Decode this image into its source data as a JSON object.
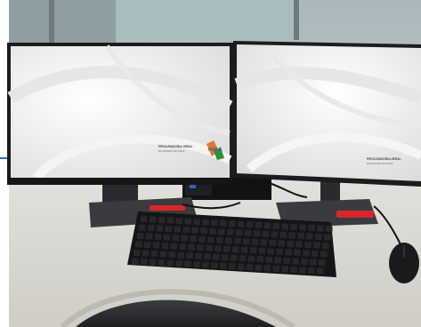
{
  "scene": {
    "subject": "dual-monitor-workstation",
    "colors": {
      "wall": "#b9c2c4",
      "window": "#9fb0b5",
      "desk": "#d9d8d2",
      "monitor_frame": "#1c1c1e",
      "screen": "#eeeeee",
      "keyboard": "#151517",
      "accent_red": "#d8262c",
      "logo_orange": "#e8742a",
      "logo_green": "#2f8f3b"
    }
  },
  "left_monitor": {
    "screen_title": "PROCURADORIA-GERAL",
    "screen_subtitle": "DO ESTADO DO PIAUÍ",
    "logo_word": "PIAUÍ"
  },
  "right_monitor": {
    "screen_title": "PROCURADORIA-GERAL",
    "screen_subtitle": "DO ESTADO DO PIAUÍ"
  }
}
